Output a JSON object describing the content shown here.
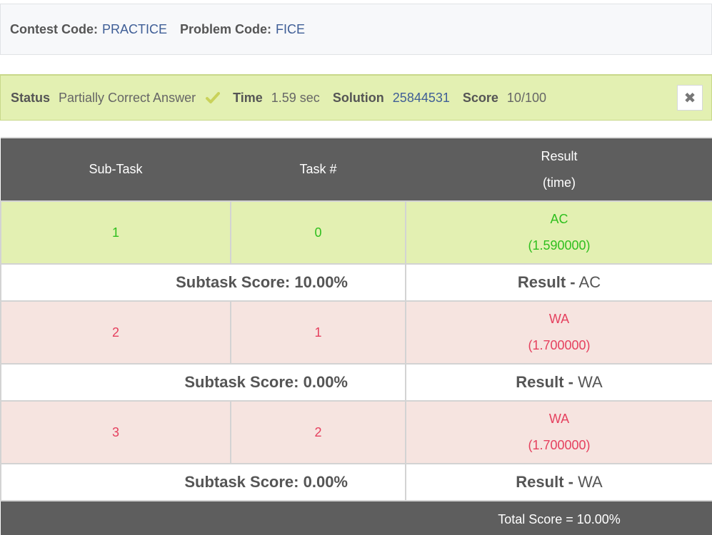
{
  "contest": {
    "contest_code_label": "Contest Code:",
    "contest_code": "PRACTICE",
    "problem_code_label": "Problem Code:",
    "problem_code": "FICE"
  },
  "status": {
    "status_label": "Status",
    "status_value": "Partially Correct Answer",
    "time_label": "Time",
    "time_value": "1.59 sec",
    "solution_label": "Solution",
    "solution_id": "25844531",
    "score_label": "Score",
    "score_value": "10/100",
    "close_icon": "✖"
  },
  "table": {
    "headers": {
      "subtask": "Sub-Task",
      "task": "Task #",
      "result": "Result",
      "result_sub": "(time)"
    },
    "rows": [
      {
        "subtask": "1",
        "task": "0",
        "result": "AC",
        "time": "(1.590000)",
        "subtask_score": "Subtask Score: 10.00%",
        "result_label": "Result -",
        "result_value": "AC"
      },
      {
        "subtask": "2",
        "task": "1",
        "result": "WA",
        "time": "(1.700000)",
        "subtask_score": "Subtask Score: 0.00%",
        "result_label": "Result -",
        "result_value": "WA"
      },
      {
        "subtask": "3",
        "task": "2",
        "result": "WA",
        "time": "(1.700000)",
        "subtask_score": "Subtask Score: 0.00%",
        "result_label": "Result -",
        "result_value": "WA"
      }
    ],
    "total": "Total Score = 10.00%"
  },
  "colors": {
    "ac_bg": "#e3f0b2",
    "ac_text": "#2fbf1e",
    "wa_bg": "#f6e4e0",
    "wa_text": "#e5405e",
    "header_bg": "#5e5e5e",
    "link": "#3f5e96"
  }
}
